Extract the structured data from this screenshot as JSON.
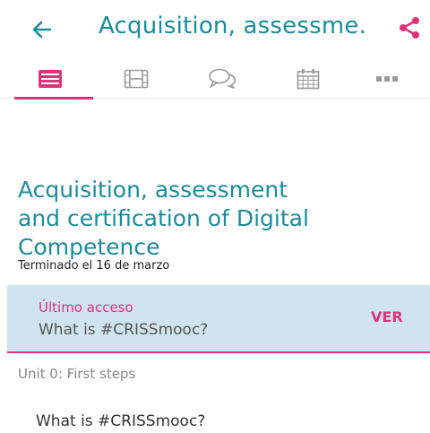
{
  "header": {
    "title": "Acquisition, assessme...",
    "back_icon": "arrow-left-icon",
    "share_icon": "share-icon",
    "accent_color": "#1a8c9c"
  },
  "tabs": [
    {
      "icon": "list-icon",
      "active": true
    },
    {
      "icon": "film-icon",
      "active": false
    },
    {
      "icon": "chat-bubbles-icon",
      "active": false
    },
    {
      "icon": "calendar-icon",
      "active": false
    },
    {
      "icon": "more-icon",
      "active": false
    }
  ],
  "course": {
    "title_lines": [
      "Acquisition, assessment",
      "and certification of Digital",
      "Competence"
    ],
    "status": "Terminado el 16 de marzo"
  },
  "last_access": {
    "label": "Último acceso",
    "item": "What is #CRISSmooc?",
    "action": "VER",
    "highlight_color": "#e0317c",
    "background": "#cfe4ee"
  },
  "unit": {
    "label": "Unit 0: First steps",
    "items": [
      "What is #CRISSmooc?"
    ]
  }
}
